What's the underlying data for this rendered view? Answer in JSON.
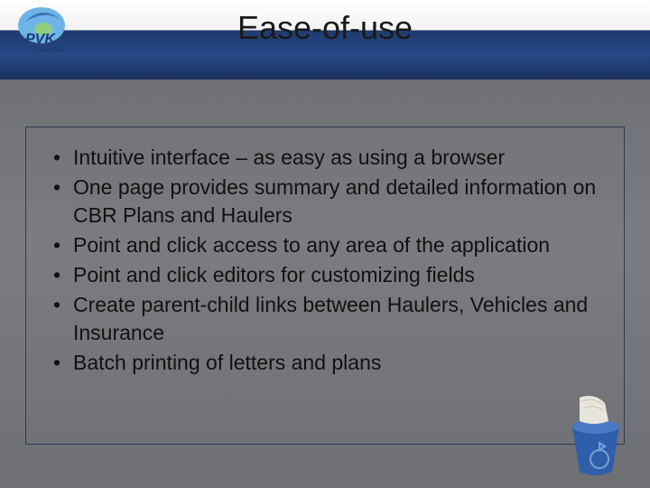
{
  "header": {
    "title": "Ease-of-use",
    "logo_text_top": "PVK",
    "logo_text_bottom": "Corporation"
  },
  "bullets": [
    "Intuitive interface – as easy as using a browser",
    "One page provides summary and detailed information on CBR Plans and Haulers",
    "Point and click access to any area of the application",
    "Point and click editors for customizing fields",
    "Create parent-child links between Haulers, Vehicles and Insurance",
    "Batch printing of letters and plans"
  ],
  "decor": {
    "corner_icon": "recycle-bin-icon"
  }
}
